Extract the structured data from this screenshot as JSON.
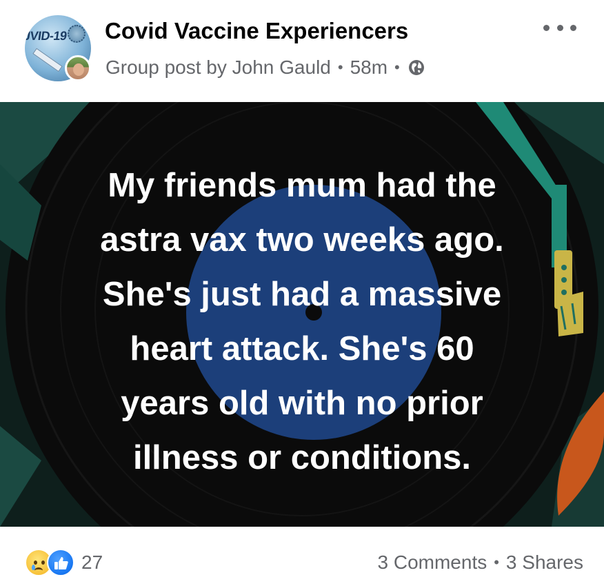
{
  "header": {
    "group_name": "Covid Vaccine Experiencers",
    "post_type_prefix": "Group post by",
    "author": "John Gauld",
    "separator": "•",
    "time_ago": "58m",
    "privacy_icon": "globe-icon",
    "group_avatar_text": "JVID-19",
    "more_icon": "more-options-icon"
  },
  "image": {
    "lines": [
      "My friends mum had the",
      "astra vax two weeks ago.",
      "She's just had a massive",
      "heart attack. She's 60",
      "years old with no prior",
      "illness or conditions."
    ],
    "colors": {
      "background": "#0e1f1c",
      "disc": "#1c3f7a",
      "accent_teal": "#1f8a76",
      "accent_orange": "#c8571c",
      "accent_yellow": "#c9b547",
      "text": "#ffffff"
    }
  },
  "footer": {
    "reaction_icons": [
      "sad-icon",
      "like-icon"
    ],
    "reaction_count": "27",
    "comments": "3 Comments",
    "separator": "•",
    "shares": "3 Shares"
  }
}
